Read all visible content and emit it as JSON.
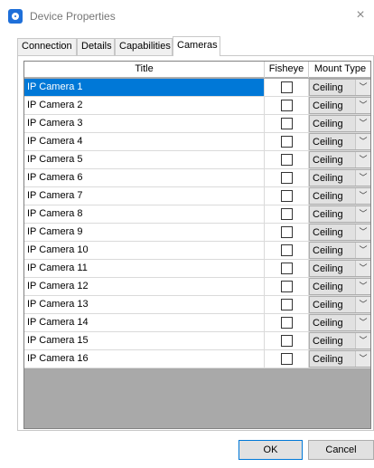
{
  "window": {
    "title": "Device Properties",
    "close_glyph": "×",
    "icon": "app-logo-icon"
  },
  "tabs": [
    {
      "label": "Connection"
    },
    {
      "label": "Details"
    },
    {
      "label": "Capabilities"
    },
    {
      "label": "Cameras",
      "active": true
    }
  ],
  "grid": {
    "columns": {
      "title": "Title",
      "fisheye": "Fisheye",
      "mount_type": "Mount Type"
    },
    "selected_row": 0,
    "rows": [
      {
        "title": "IP Camera 1",
        "fisheye": false,
        "mount": "Ceiling"
      },
      {
        "title": "IP Camera 2",
        "fisheye": false,
        "mount": "Ceiling"
      },
      {
        "title": "IP Camera 3",
        "fisheye": false,
        "mount": "Ceiling"
      },
      {
        "title": "IP Camera 4",
        "fisheye": false,
        "mount": "Ceiling"
      },
      {
        "title": "IP Camera 5",
        "fisheye": false,
        "mount": "Ceiling"
      },
      {
        "title": "IP Camera 6",
        "fisheye": false,
        "mount": "Ceiling"
      },
      {
        "title": "IP Camera 7",
        "fisheye": false,
        "mount": "Ceiling"
      },
      {
        "title": "IP Camera 8",
        "fisheye": false,
        "mount": "Ceiling"
      },
      {
        "title": "IP Camera 9",
        "fisheye": false,
        "mount": "Ceiling"
      },
      {
        "title": "IP Camera 10",
        "fisheye": false,
        "mount": "Ceiling"
      },
      {
        "title": "IP Camera 11",
        "fisheye": false,
        "mount": "Ceiling"
      },
      {
        "title": "IP Camera 12",
        "fisheye": false,
        "mount": "Ceiling"
      },
      {
        "title": "IP Camera 13",
        "fisheye": false,
        "mount": "Ceiling"
      },
      {
        "title": "IP Camera 14",
        "fisheye": false,
        "mount": "Ceiling"
      },
      {
        "title": "IP Camera 15",
        "fisheye": false,
        "mount": "Ceiling"
      },
      {
        "title": "IP Camera 16",
        "fisheye": false,
        "mount": "Ceiling"
      }
    ]
  },
  "buttons": {
    "ok": "OK",
    "cancel": "Cancel"
  },
  "colors": {
    "accent": "#0078d7",
    "grid_empty": "#a9a9a9",
    "button_face": "#e1e1e1"
  }
}
